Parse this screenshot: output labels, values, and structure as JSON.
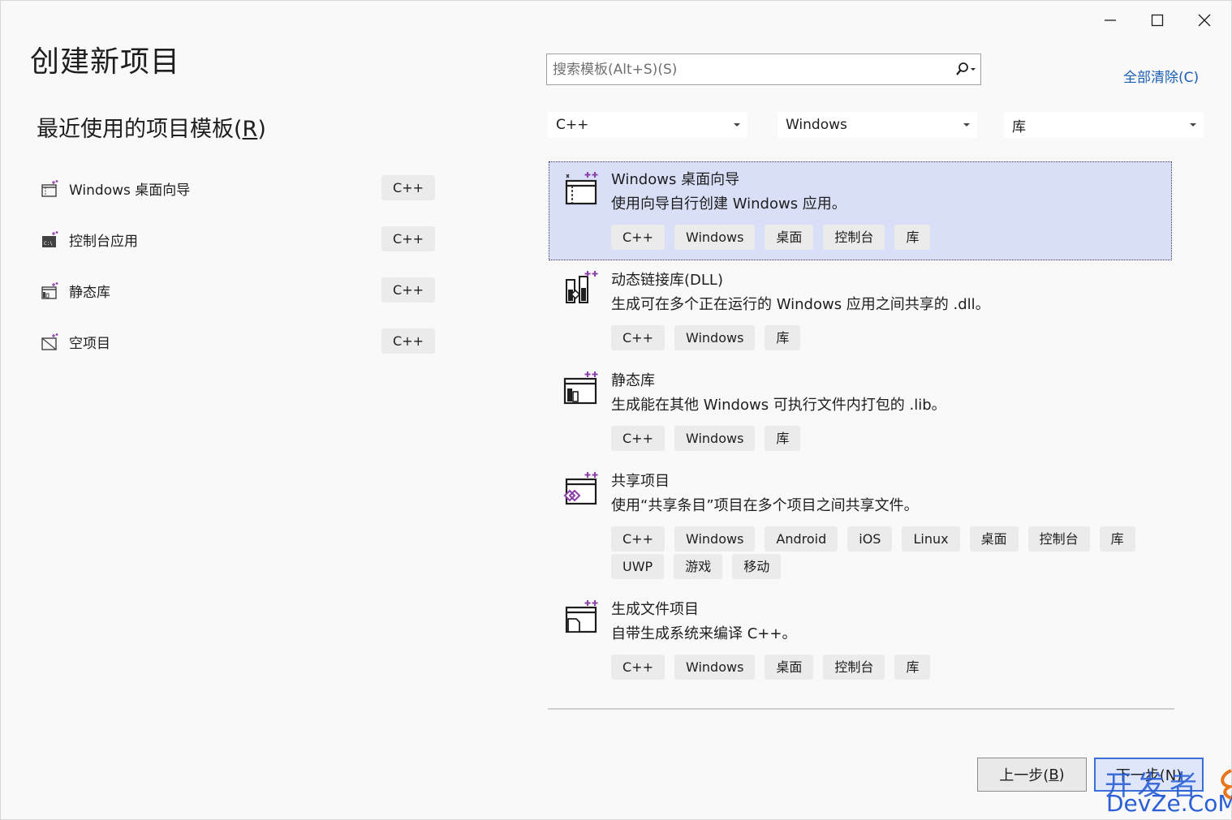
{
  "window": {
    "title": "创建新项目",
    "controls": [
      "minimize-icon",
      "maximize-icon",
      "close-icon"
    ]
  },
  "recent": {
    "heading": "最近使用的项目模板(",
    "heading_mnemonic": "R",
    "heading_close": ")",
    "items": [
      {
        "label": "Windows 桌面向导",
        "tag": "C++",
        "icon": "windows-desktop-wizard-icon"
      },
      {
        "label": "控制台应用",
        "tag": "C++",
        "icon": "console-app-icon"
      },
      {
        "label": "静态库",
        "tag": "C++",
        "icon": "static-library-icon"
      },
      {
        "label": "空项目",
        "tag": "C++",
        "icon": "empty-project-icon"
      }
    ]
  },
  "search": {
    "placeholder": "搜索模板(Alt+S)(S)",
    "icon": "search-icon"
  },
  "clear_all": "全部清除(C)",
  "filters": {
    "language": "C++",
    "platform": "Windows",
    "project_type": "库"
  },
  "templates": [
    {
      "name": "Windows 桌面向导",
      "description": "使用向导自行创建 Windows 应用。",
      "tags": [
        "C++",
        "Windows",
        "桌面",
        "控制台",
        "库"
      ],
      "selected": true,
      "icon": "windows-desktop-wizard-icon"
    },
    {
      "name": "动态链接库(DLL)",
      "description": "生成可在多个正在运行的 Windows 应用之间共享的 .dll。",
      "tags": [
        "C++",
        "Windows",
        "库"
      ],
      "selected": false,
      "icon": "dll-icon"
    },
    {
      "name": "静态库",
      "description": "生成能在其他 Windows 可执行文件内打包的 .lib。",
      "tags": [
        "C++",
        "Windows",
        "库"
      ],
      "selected": false,
      "icon": "static-library-icon"
    },
    {
      "name": "共享项目",
      "description": "使用“共享条目”项目在多个项目之间共享文件。",
      "tags": [
        "C++",
        "Windows",
        "Android",
        "iOS",
        "Linux",
        "桌面",
        "控制台",
        "库",
        "UWP",
        "游戏",
        "移动"
      ],
      "selected": false,
      "icon": "shared-project-icon"
    },
    {
      "name": "生成文件项目",
      "description": "自带生成系统来编译 C++。",
      "tags": [
        "C++",
        "Windows",
        "桌面",
        "控制台",
        "库"
      ],
      "selected": false,
      "icon": "makefile-project-icon"
    }
  ],
  "buttons": {
    "back_label": "上一步(",
    "back_mnemonic": "B",
    "back_close": ")",
    "next_label": "下一步(N)"
  },
  "watermark": {
    "line1": "开发者",
    "line2": "DevZe.CoM"
  },
  "colors": {
    "accent": "#1a5fb4",
    "selected_bg": "#dadff8",
    "tag_bg": "#ebebeb",
    "icon_purple": "#8b3fa8"
  }
}
